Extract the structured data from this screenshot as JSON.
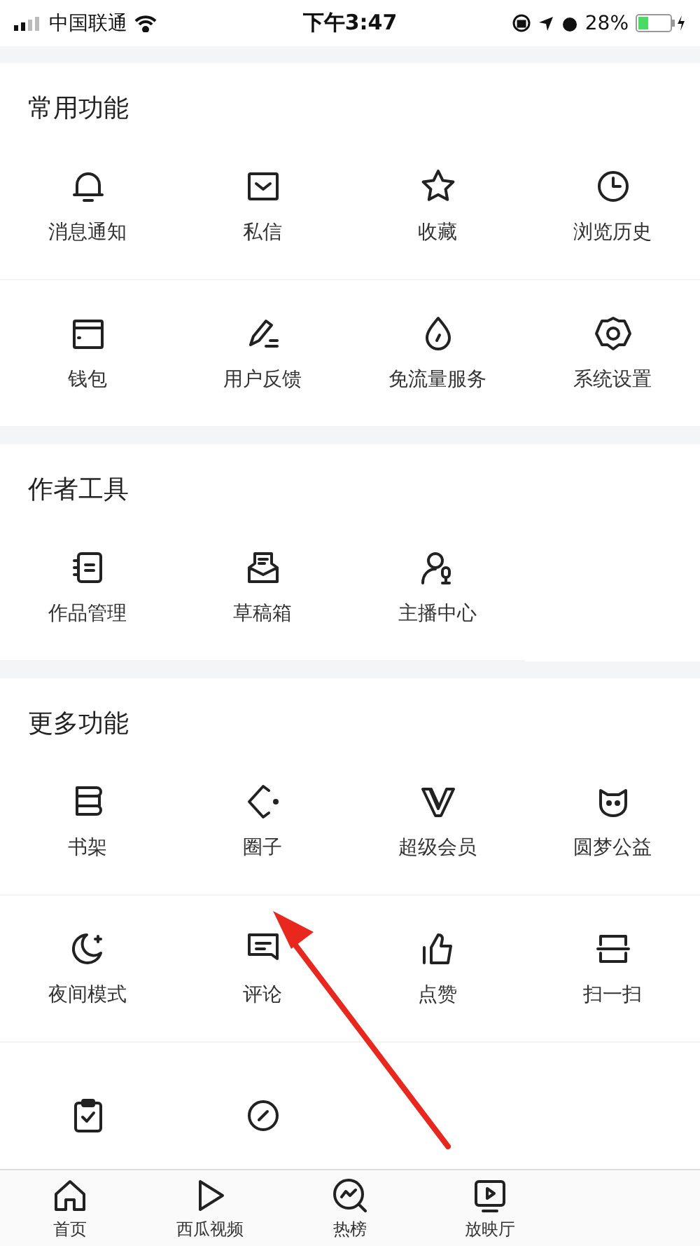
{
  "status_bar": {
    "carrier": "中国联通",
    "time": "下午3:47",
    "battery": "28%"
  },
  "sections": [
    {
      "title": "常用功能",
      "items": [
        {
          "label": "消息通知"
        },
        {
          "label": "私信"
        },
        {
          "label": "收藏"
        },
        {
          "label": "浏览历史"
        },
        {
          "label": "钱包"
        },
        {
          "label": "用户反馈"
        },
        {
          "label": "免流量服务"
        },
        {
          "label": "系统设置"
        }
      ]
    },
    {
      "title": "作者工具",
      "items": [
        {
          "label": "作品管理"
        },
        {
          "label": "草稿箱"
        },
        {
          "label": "主播中心"
        }
      ]
    },
    {
      "title": "更多功能",
      "items": [
        {
          "label": "书架"
        },
        {
          "label": "圈子"
        },
        {
          "label": "超级会员"
        },
        {
          "label": "圆梦公益"
        },
        {
          "label": "夜间模式"
        },
        {
          "label": "评论"
        },
        {
          "label": "点赞"
        },
        {
          "label": "扫一扫"
        },
        {
          "kind": "cut_off"
        },
        {
          "kind": "cut_off"
        }
      ]
    }
  ],
  "tab_bar": [
    {
      "label": "首页",
      "selected": false
    },
    {
      "label": "西瓜视频",
      "selected": false
    },
    {
      "label": "热榜",
      "selected": false
    },
    {
      "label": "放映厅",
      "selected": false
    }
  ]
}
